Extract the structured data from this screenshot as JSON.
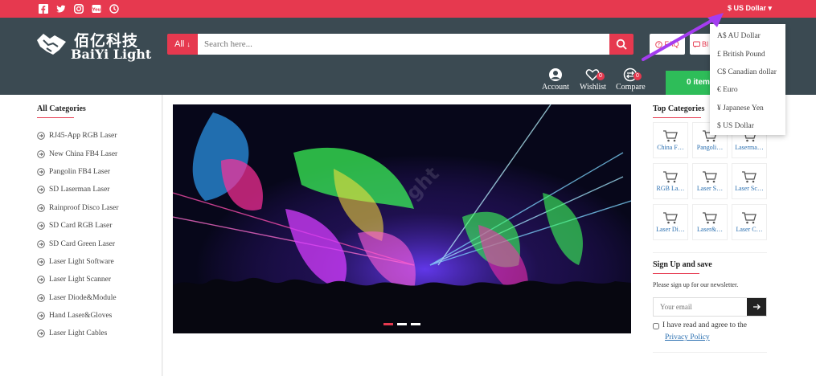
{
  "topbar": {
    "social_icons": [
      "facebook-icon",
      "twitter-icon",
      "instagram-icon",
      "youtube-icon",
      "clock-icon"
    ],
    "currency_label": "$ US Dollar"
  },
  "logo": {
    "cn": "佰亿科技",
    "en": "BaiYi Light"
  },
  "search": {
    "category": "All",
    "placeholder": "Search here..."
  },
  "header_buttons": {
    "faq": "FAQ",
    "blog": "Bl"
  },
  "header_icons": {
    "account": "Account",
    "wishlist": "Wishlist",
    "wishlist_count": "0",
    "compare": "Compare",
    "compare_count": "0"
  },
  "cart": {
    "label": "0 item("
  },
  "left_sidebar": {
    "title": "All Categories",
    "items": [
      "RJ45-App RGB Laser",
      "New China FB4 Laser",
      "Pangolin FB4 Laser",
      "SD Laserman Laser",
      "Rainproof Disco Laser",
      "SD Card RGB Laser",
      "SD Card Green Laser",
      "Laser Light Software",
      "Laser Light Scanner",
      "Laser Diode&Module",
      "Hand Laser&Gloves",
      "Laser Light Cables"
    ]
  },
  "banner": {
    "slides": 3,
    "active_slide": 1
  },
  "right_sidebar": {
    "top_title": "Top Categories",
    "tiles": [
      "China F…",
      "Pangoli…",
      "Laserma…",
      "RGB La…",
      "Laser S…",
      "Laser Sc…",
      "Laser Di…",
      "Laser&…",
      "Laser C…"
    ],
    "signup_title": "Sign Up and save",
    "signup_desc": "Please sign up for our newsletter.",
    "email_placeholder": "Your email",
    "agree_text": "I have read and agree to the",
    "privacy_link": "Privacy Policy"
  },
  "currency_dropdown": {
    "options": [
      "A$ AU Dollar",
      "£ British Pound",
      "C$ Canadian dollar",
      "€ Euro",
      "¥ Japanese Yen",
      "$ US Dollar"
    ]
  },
  "colors": {
    "accent": "#e6394f",
    "header": "#3b4a52",
    "cart": "#2ebd59",
    "link": "#2a6fb0"
  }
}
